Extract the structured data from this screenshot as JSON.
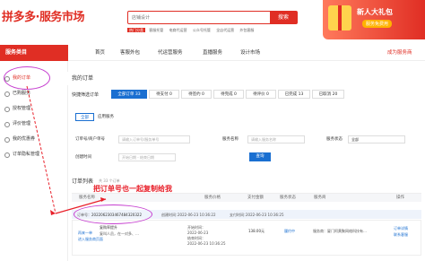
{
  "brand": {
    "logo": "拼多多·服务市场"
  },
  "search": {
    "placeholder": "店铺设计",
    "button": "搜索"
  },
  "hot": {
    "tag": "热门分类",
    "items": [
      "客服托管",
      "电商代运营",
      "公众号托管",
      "全店代运营",
      "外包客服"
    ]
  },
  "banner": {
    "title": "新人大礼包",
    "cta": "服务免费用"
  },
  "nav": {
    "category": "服务类目",
    "items": [
      "首页",
      "客服外包",
      "代运营服务",
      "直播服务",
      "设计市场"
    ],
    "become": "成为服务商"
  },
  "sidebar": {
    "items": [
      "我的订单",
      "已购服务",
      "授权管理",
      "评价管理",
      "我的优惠券",
      "订单隐私管理"
    ]
  },
  "main": {
    "title": "我的订单",
    "quick_label": "快捷筛选订单",
    "quick_tabs": [
      "全部订单 33",
      "待支付 0",
      "待签约 0",
      "待完成 0",
      "待评价 0",
      "已完成 13",
      "已取消 20"
    ],
    "sub_tabs": [
      "全部",
      "应用服务"
    ],
    "filters": {
      "order_label": "订单号/商户单号",
      "order_placeholder": "请输入订单号/服务单号",
      "service_label": "服务名称",
      "service_placeholder": "请输入服务名称",
      "status_label": "服务状态",
      "status_value": "全部",
      "time_label": "创建时间",
      "time_placeholder": "开始日期 - 结束日期",
      "query_button": "查询"
    },
    "list_title": "订单列表",
    "list_count": "共 33 个订单",
    "columns": [
      "服务名称",
      "服务价格",
      "支付金额",
      "服务状态",
      "服务商",
      "操作"
    ],
    "order": {
      "order_no_label": "订单号：",
      "order_no": "2022062303467484320322",
      "created_label": "创建时间：",
      "created": "2022-06-23 10:36:22",
      "paid_label": "支付时间：",
      "paid": "2022-06-23 10:36:25",
      "service_name": "服务名称：",
      "name": "复购率提升",
      "desc": "复叫人员，在一对多、…",
      "link": "再来一单",
      "link2": "进入服务商页面",
      "start_label": "开始时间：",
      "start": "2022-06-23",
      "end_label": "结束时间：",
      "end": "2022-06-23 10:36:25",
      "amount": "138.00元",
      "status": "履约中",
      "provider": "服务商：厦门阿黄聚网络科技有…",
      "op1": "订单详情",
      "op2": "联系客服"
    }
  },
  "annotation": {
    "text": "把订单号也一起复制给我"
  },
  "colors": {
    "brand_red": "#e02e24",
    "link_blue": "#1a6fd1",
    "annotation_red": "#e8202a",
    "circle_purple": "#c63fd0"
  }
}
